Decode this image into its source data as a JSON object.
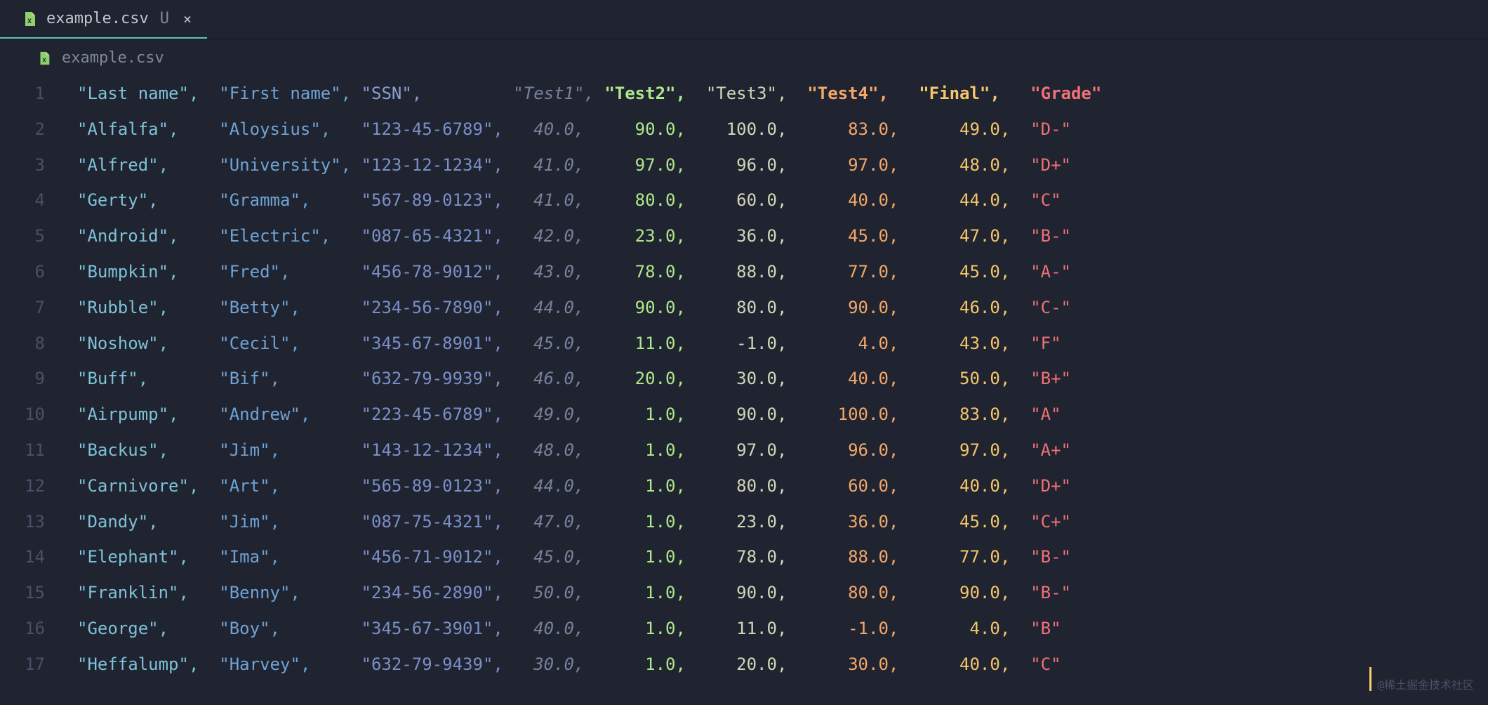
{
  "tab": {
    "filename": "example.csv",
    "modified_indicator": "U",
    "close_glyph": "×"
  },
  "breadcrumb": {
    "filename": "example.csv"
  },
  "footer_credit": "@稀土掘金技术社区",
  "csv": {
    "header": {
      "last": "\"Last name\",",
      "first": "\"First name\",",
      "ssn": "\"SSN\",",
      "test1": "\"Test1\",",
      "test2": "\"Test2\",",
      "test3": "\"Test3\",",
      "test4": "\"Test4\",",
      "final": "\"Final\",",
      "grade": "\"Grade\""
    },
    "rows": [
      {
        "n": "1"
      },
      {
        "n": "2",
        "last": "\"Alfalfa\",",
        "first": "\"Aloysius\",",
        "ssn": "\"123-45-6789\",",
        "t1": "40.0,",
        "t2": "90.0,",
        "t3": "100.0,",
        "t4": "83.0,",
        "fin": "49.0,",
        "gr": "\"D-\""
      },
      {
        "n": "3",
        "last": "\"Alfred\",",
        "first": "\"University\",",
        "ssn": "\"123-12-1234\",",
        "t1": "41.0,",
        "t2": "97.0,",
        "t3": "96.0,",
        "t4": "97.0,",
        "fin": "48.0,",
        "gr": "\"D+\""
      },
      {
        "n": "4",
        "last": "\"Gerty\",",
        "first": "\"Gramma\",",
        "ssn": "\"567-89-0123\",",
        "t1": "41.0,",
        "t2": "80.0,",
        "t3": "60.0,",
        "t4": "40.0,",
        "fin": "44.0,",
        "gr": "\"C\""
      },
      {
        "n": "5",
        "last": "\"Android\",",
        "first": "\"Electric\",",
        "ssn": "\"087-65-4321\",",
        "t1": "42.0,",
        "t2": "23.0,",
        "t3": "36.0,",
        "t4": "45.0,",
        "fin": "47.0,",
        "gr": "\"B-\""
      },
      {
        "n": "6",
        "last": "\"Bumpkin\",",
        "first": "\"Fred\",",
        "ssn": "\"456-78-9012\",",
        "t1": "43.0,",
        "t2": "78.0,",
        "t3": "88.0,",
        "t4": "77.0,",
        "fin": "45.0,",
        "gr": "\"A-\""
      },
      {
        "n": "7",
        "last": "\"Rubble\",",
        "first": "\"Betty\",",
        "ssn": "\"234-56-7890\",",
        "t1": "44.0,",
        "t2": "90.0,",
        "t3": "80.0,",
        "t4": "90.0,",
        "fin": "46.0,",
        "gr": "\"C-\""
      },
      {
        "n": "8",
        "last": "\"Noshow\",",
        "first": "\"Cecil\",",
        "ssn": "\"345-67-8901\",",
        "t1": "45.0,",
        "t2": "11.0,",
        "t3": "-1.0,",
        "t4": "4.0,",
        "fin": "43.0,",
        "gr": "\"F\""
      },
      {
        "n": "9",
        "last": "\"Buff\",",
        "first": "\"Bif\",",
        "ssn": "\"632-79-9939\",",
        "t1": "46.0,",
        "t2": "20.0,",
        "t3": "30.0,",
        "t4": "40.0,",
        "fin": "50.0,",
        "gr": "\"B+\""
      },
      {
        "n": "10",
        "last": "\"Airpump\",",
        "first": "\"Andrew\",",
        "ssn": "\"223-45-6789\",",
        "t1": "49.0,",
        "t2": "1.0,",
        "t3": "90.0,",
        "t4": "100.0,",
        "fin": "83.0,",
        "gr": "\"A\""
      },
      {
        "n": "11",
        "last": "\"Backus\",",
        "first": "\"Jim\",",
        "ssn": "\"143-12-1234\",",
        "t1": "48.0,",
        "t2": "1.0,",
        "t3": "97.0,",
        "t4": "96.0,",
        "fin": "97.0,",
        "gr": "\"A+\""
      },
      {
        "n": "12",
        "last": "\"Carnivore\",",
        "first": "\"Art\",",
        "ssn": "\"565-89-0123\",",
        "t1": "44.0,",
        "t2": "1.0,",
        "t3": "80.0,",
        "t4": "60.0,",
        "fin": "40.0,",
        "gr": "\"D+\""
      },
      {
        "n": "13",
        "last": "\"Dandy\",",
        "first": "\"Jim\",",
        "ssn": "\"087-75-4321\",",
        "t1": "47.0,",
        "t2": "1.0,",
        "t3": "23.0,",
        "t4": "36.0,",
        "fin": "45.0,",
        "gr": "\"C+\""
      },
      {
        "n": "14",
        "last": "\"Elephant\",",
        "first": "\"Ima\",",
        "ssn": "\"456-71-9012\",",
        "t1": "45.0,",
        "t2": "1.0,",
        "t3": "78.0,",
        "t4": "88.0,",
        "fin": "77.0,",
        "gr": "\"B-\""
      },
      {
        "n": "15",
        "last": "\"Franklin\",",
        "first": "\"Benny\",",
        "ssn": "\"234-56-2890\",",
        "t1": "50.0,",
        "t2": "1.0,",
        "t3": "90.0,",
        "t4": "80.0,",
        "fin": "90.0,",
        "gr": "\"B-\""
      },
      {
        "n": "16",
        "last": "\"George\",",
        "first": "\"Boy\",",
        "ssn": "\"345-67-3901\",",
        "t1": "40.0,",
        "t2": "1.0,",
        "t3": "11.0,",
        "t4": "-1.0,",
        "fin": "4.0,",
        "gr": "\"B\""
      },
      {
        "n": "17",
        "last": "\"Heffalump\",",
        "first": "\"Harvey\",",
        "ssn": "\"632-79-9439\",",
        "t1": "30.0,",
        "t2": "1.0,",
        "t3": "20.0,",
        "t4": "30.0,",
        "fin": "40.0,",
        "gr": "\"C\""
      }
    ]
  }
}
